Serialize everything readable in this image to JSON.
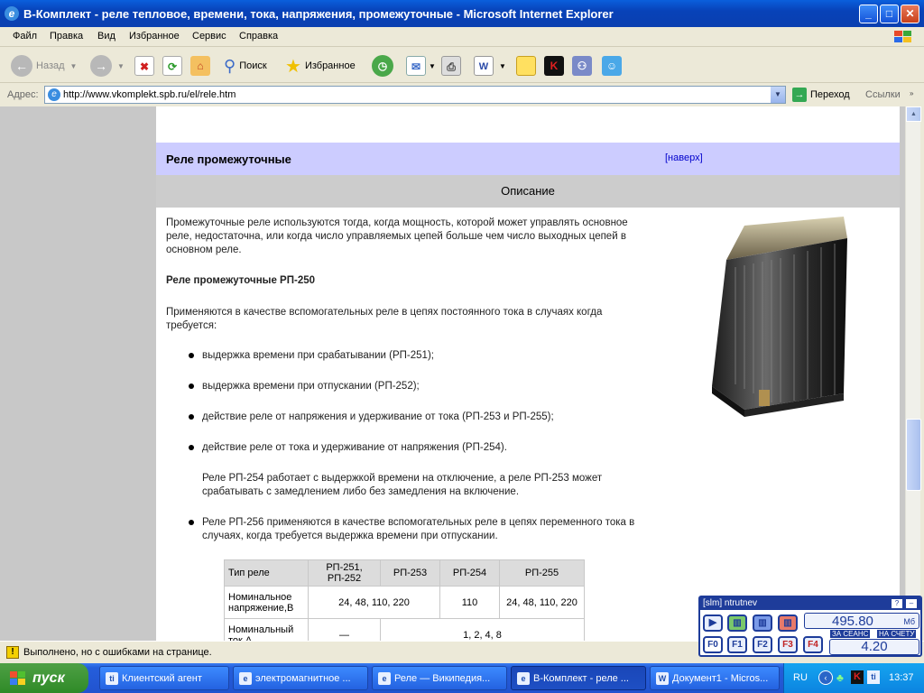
{
  "window": {
    "title": "В-Комплект - реле тепловое, времени, тока, напряжения, промежуточные - Microsoft Internet Explorer",
    "min": "_",
    "max": "□",
    "close": "✕"
  },
  "menu": [
    "Файл",
    "Правка",
    "Вид",
    "Избранное",
    "Сервис",
    "Справка"
  ],
  "toolbar": {
    "back": "Назад",
    "search": "Поиск",
    "favorites": "Избранное"
  },
  "address": {
    "label": "Адрес:",
    "url": "http://www.vkomplekt.spb.ru/el/rele.htm",
    "go": "Переход",
    "links": "Ссылки"
  },
  "page": {
    "section_title": "Реле промежуточные",
    "top_link": "[наверх]",
    "description_header": "Описание",
    "intro": "Промежуточные реле используются тогда, когда мощность, которой может управлять основное реле, недостаточна, или когда число управляемых цепей больше чем число выходных цепей в основном реле.",
    "subtitle": "Реле промежуточные РП-250",
    "applied": "Применяются в качестве вспомогательных реле в цепях постоянного тока в случаях когда требуется:",
    "bullets": [
      "выдержка времени при срабатывании (РП-251);",
      "выдержка времени при отпускании (РП-252);",
      "действие реле от напряжения и удерживание от тока (РП-253 и РП-255);",
      "действие реле от тока и удерживание от напряжения (РП-254)."
    ],
    "note": "Реле РП-254 работает с выдержкой времени на отключение, а реле РП-253 может срабатывать с замедлением либо без замедления на включение.",
    "bullet_rp256": "Реле РП-256 применяются в качестве вспомогательных реле в цепях переменного тока в случаях, когда требуется выдержка времени при отпускании.",
    "table": {
      "headers": [
        "Тип реле",
        "РП-251, РП-252",
        "РП-253",
        "РП-254",
        "РП-255"
      ],
      "row1": {
        "label": "Номинальное напряжение,В",
        "v1": "24, 48, 110, 220",
        "v2": "110",
        "v3": "24, 48, 110, 220"
      },
      "row2": {
        "label": "Номинальный ток,А",
        "v1": "—",
        "v2": "1, 2, 4, 8"
      }
    }
  },
  "status": {
    "text": "Выполнено, но с ошибками на странице."
  },
  "taskbar": {
    "start": "пуск",
    "tasks": [
      "Клиентский агент",
      "электромагнитное ...",
      "Реле — Википедия...",
      "В-Комплект - реле ...",
      "Документ1 - Micros..."
    ],
    "lang": "RU",
    "time": "13:37"
  },
  "widget": {
    "user": "[slm] ntrutnev",
    "value1": "495.80",
    "unit": "Мб",
    "label_session": "ЗА СЕАНС",
    "label_account": "НА СЧЕТУ",
    "value2": "4.20",
    "keys": [
      "F0",
      "F1",
      "F2",
      "F3",
      "F4"
    ]
  }
}
